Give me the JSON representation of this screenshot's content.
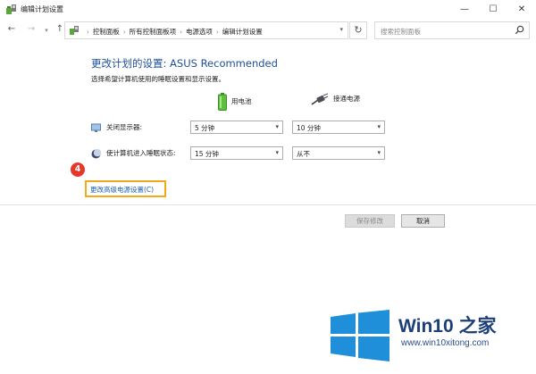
{
  "window": {
    "title": "编辑计划设置",
    "minimize_glyph": "—",
    "maximize_glyph": "☐",
    "close_glyph": "✕"
  },
  "nav": {
    "back_glyph": "←",
    "forward_glyph": "→",
    "recent_glyph": "▾",
    "up_glyph": "↑",
    "breadcrumbs": [
      "控制面板",
      "所有控制面板项",
      "电源选项",
      "编辑计划设置"
    ],
    "separator": "›",
    "refresh_glyph": "↻",
    "search_placeholder": "搜索控制面板"
  },
  "main": {
    "heading": "更改计划的设置: ASUS Recommended",
    "subtitle": "选择希望计算机使用的睡眠设置和显示设置。",
    "col_battery": "用电池",
    "col_plugged": "接通电源",
    "rows": [
      {
        "label": "关闭显示器:",
        "battery": "5 分钟",
        "plugged": "10 分钟"
      },
      {
        "label": "使计算机进入睡眠状态:",
        "battery": "15 分钟",
        "plugged": "从不"
      }
    ],
    "step_number": "4",
    "advanced_link": "更改高级电源设置(C)",
    "save_label": "保存修改",
    "cancel_label": "取消"
  },
  "watermark": {
    "brand": "Win10 之家",
    "url": "www.win10xitong.com",
    "color": "#1e8fd8"
  }
}
